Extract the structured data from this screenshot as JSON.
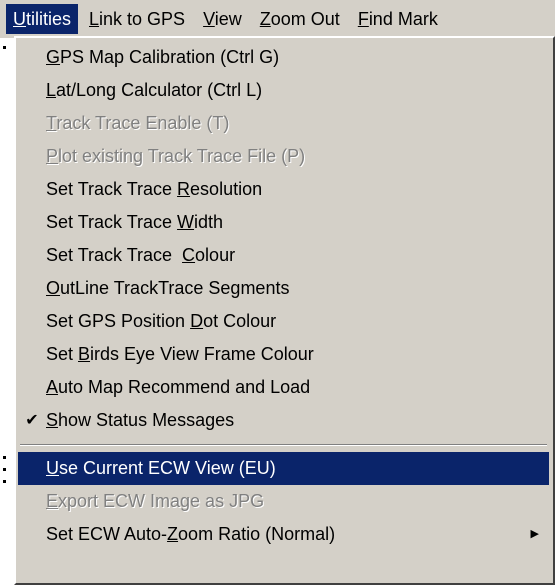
{
  "menubar": {
    "items": [
      {
        "label": "Utilities",
        "active": true
      },
      {
        "label": "Link to GPS",
        "active": false
      },
      {
        "label": "View",
        "active": false
      },
      {
        "label": "Zoom Out",
        "active": false
      },
      {
        "label": "Find Mark",
        "active": false
      }
    ]
  },
  "dropdown": {
    "items": [
      {
        "pre": "",
        "u": "G",
        "post": "PS Map Calibration (Ctrl G)",
        "disabled": false
      },
      {
        "pre": "",
        "u": "L",
        "post": "at/Long Calculator (Ctrl L)",
        "disabled": false
      },
      {
        "pre": "",
        "u": "T",
        "post": "rack Trace Enable (T)",
        "disabled": true
      },
      {
        "pre": "",
        "u": "P",
        "post": "lot existing Track Trace File (P)",
        "disabled": true
      },
      {
        "pre": "Set Track Trace ",
        "u": "R",
        "post": "esolution",
        "disabled": false
      },
      {
        "pre": "Set Track Trace ",
        "u": "W",
        "post": "idth",
        "disabled": false
      },
      {
        "pre": "Set Track Trace  ",
        "u": "C",
        "post": "olour",
        "disabled": false
      },
      {
        "pre": "",
        "u": "O",
        "post": "utLine TrackTrace Segments",
        "disabled": false
      },
      {
        "pre": "Set GPS Position ",
        "u": "D",
        "post": "ot Colour",
        "disabled": false
      },
      {
        "pre": "Set ",
        "u": "B",
        "post": "irds Eye View Frame Colour",
        "disabled": false
      },
      {
        "pre": "",
        "u": "A",
        "post": "uto Map Recommend and Load",
        "disabled": false
      },
      {
        "pre": "",
        "u": "S",
        "post": "how Status Messages",
        "disabled": false,
        "checked": true,
        "check_glyph": "✔"
      }
    ],
    "items_after_separator": [
      {
        "pre": "",
        "u": "U",
        "post": "se Current ECW View (EU)",
        "disabled": false,
        "highlighted": true
      },
      {
        "pre": "",
        "u": "E",
        "post": "xport ECW Image as JPG",
        "disabled": true
      },
      {
        "pre": "Set ECW Auto-",
        "u": "Z",
        "post": "oom Ratio (Normal)",
        "disabled": false,
        "submenu": true,
        "arrow_glyph": "▶"
      }
    ]
  },
  "colors": {
    "menu_bg": "#d4d0c8",
    "highlight_bg": "#0a246a",
    "disabled_text": "#808080"
  }
}
